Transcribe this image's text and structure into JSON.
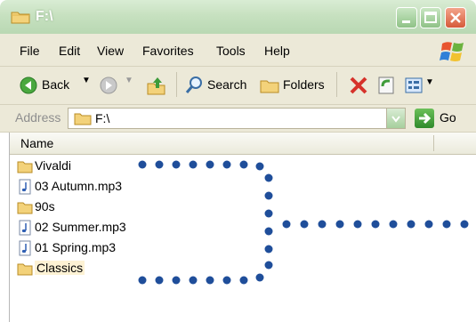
{
  "window": {
    "title": "F:\\"
  },
  "menu": {
    "items": [
      {
        "label": "File",
        "name": "menu-file"
      },
      {
        "label": "Edit",
        "name": "menu-edit"
      },
      {
        "label": "View",
        "name": "menu-view"
      },
      {
        "label": "Favorites",
        "name": "menu-favorites"
      },
      {
        "label": "Tools",
        "name": "menu-tools"
      },
      {
        "label": "Help",
        "name": "menu-help"
      }
    ]
  },
  "toolbar": {
    "back_label": "Back",
    "search_label": "Search",
    "folders_label": "Folders"
  },
  "address": {
    "label": "Address",
    "value": "F:\\",
    "go_label": "Go"
  },
  "list": {
    "column_name": "Name",
    "items": [
      {
        "label": "Vivaldi",
        "type": "folder"
      },
      {
        "label": "03 Autumn.mp3",
        "type": "audio"
      },
      {
        "label": "90s",
        "type": "folder"
      },
      {
        "label": "02 Summer.mp3",
        "type": "audio"
      },
      {
        "label": "01 Spring.mp3",
        "type": "audio"
      },
      {
        "label": "Classics",
        "type": "folder",
        "selected": true
      }
    ]
  },
  "colors": {
    "dots": "#1f4e9a",
    "titlebar": "#c7e1c0",
    "chrome": "#ece9d8"
  }
}
